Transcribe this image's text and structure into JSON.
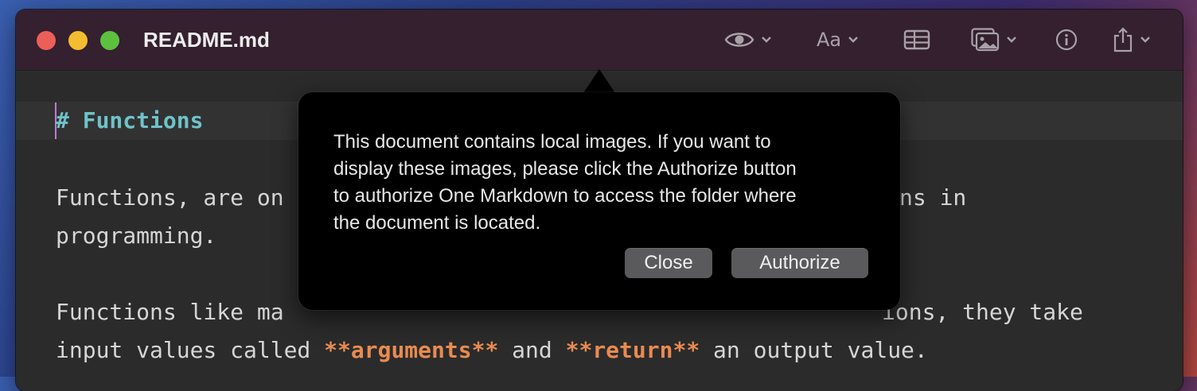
{
  "window": {
    "title": "README.md"
  },
  "toolbar": {
    "preview_icon": "eye-icon",
    "font_label": "Aa",
    "table_icon": "table-icon",
    "image_icon": "image-icon",
    "info_icon": "info-icon",
    "share_icon": "share-icon"
  },
  "editor": {
    "line1": "# Functions",
    "line2_before": "Functions, are on",
    "line2_after": "ns in",
    "line3": "programming.",
    "line4_before": "Functions like ma",
    "line4_after": "ions, they take",
    "line5_a": "input values called ",
    "line5_bold1": "**arguments**",
    "line5_b": " and ",
    "line5_bold2": "**return**",
    "line5_c": " an output value."
  },
  "popover": {
    "message": "This document contains local images. If you want to\ndisplay these images, please click the Authorize button\nto authorize  One Markdown to access the folder where\nthe document is located.",
    "close_label": "Close",
    "authorize_label": "Authorize"
  },
  "colors": {
    "titlebar": "#34202f",
    "editor_bg": "#2b2b2c",
    "heading": "#6ec3c7",
    "bold_text": "#e98b50",
    "popover_bg": "#000000"
  }
}
